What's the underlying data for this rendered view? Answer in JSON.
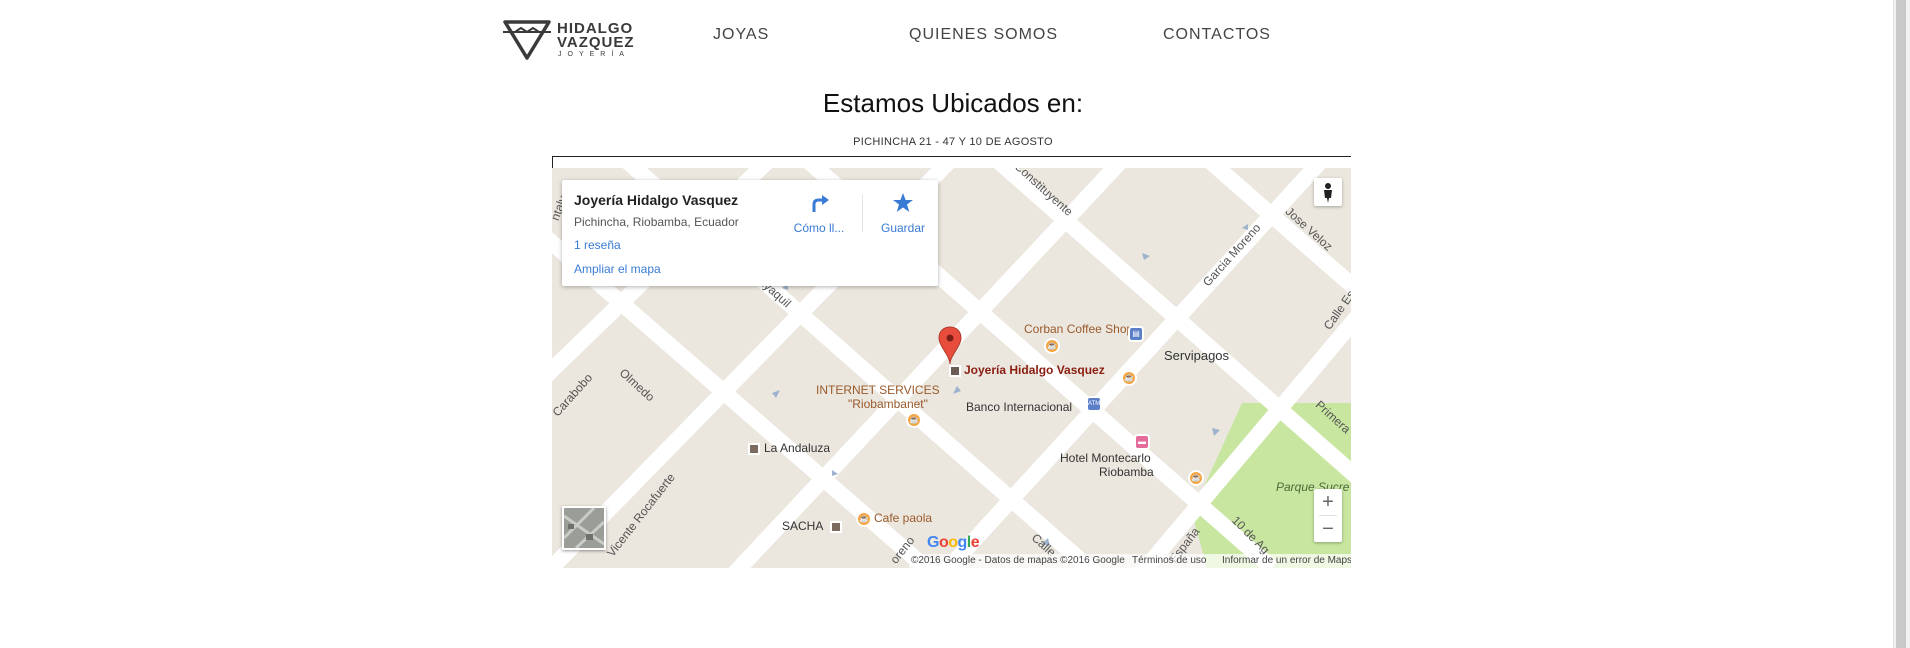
{
  "brand": {
    "line1": "HIDALGO",
    "line2": "VAZQUEZ",
    "line3": "JOYERÍA"
  },
  "nav": {
    "items": [
      {
        "label": "JOYAS"
      },
      {
        "label": "QUIENES SOMOS"
      },
      {
        "label": "CONTACTOS"
      }
    ]
  },
  "location": {
    "heading": "Estamos Ubicados en:",
    "address": "PICHINCHA 21 - 47 Y 10 DE AGOSTO"
  },
  "map": {
    "card": {
      "title": "Joyería Hidalgo Vasquez",
      "address": "Pichincha, Riobamba, Ecuador",
      "reviews_link": "1 reseña",
      "enlarge_link": "Ampliar el mapa",
      "directions_label": "Cómo ll...",
      "save_label": "Guardar"
    },
    "streets": {
      "s1": "Constituyente",
      "s2": "Garcia Moreno",
      "s3": "Jose Veloz",
      "s4": "Calle Es",
      "s5": "Primera",
      "s6": "Guayaquil",
      "s7": "Olmedo",
      "s8": "Carabobo",
      "s9": "Vicente Rocafuerte",
      "s10": "10 de Ag",
      "s11": "España",
      "s12": "Calle",
      "s13": "oreno",
      "s14": "ntalvo"
    },
    "places": {
      "marker_label": "Joyería Hidalgo Vasquez",
      "corban": "Corban Coffee Shop",
      "servipagos": "Servipagos",
      "internet_line1": "INTERNET SERVICES",
      "internet_line2": "\"Riobambanet\"",
      "banco": "Banco Internacional",
      "andaluza": "La Andaluza",
      "hotel_line1": "Hotel Montecarlo",
      "hotel_line2": "Riobamba",
      "sacha": "SACHA",
      "cafe_paola": "Cafe paola",
      "parque": "Parque Sucre"
    },
    "zoom_in": "+",
    "zoom_out": "−",
    "footer": {
      "copyright": "©2016 Google - Datos de mapas ©2016 Google",
      "terms": "Términos de uso",
      "report": "Informar de un error de Maps"
    },
    "google_logo": "Google",
    "colors": {
      "land": "#ebe7df",
      "road": "#ffffff",
      "park": "#c8e6a0",
      "marker": "#e74c3c",
      "link": "#3a7bd5"
    }
  }
}
